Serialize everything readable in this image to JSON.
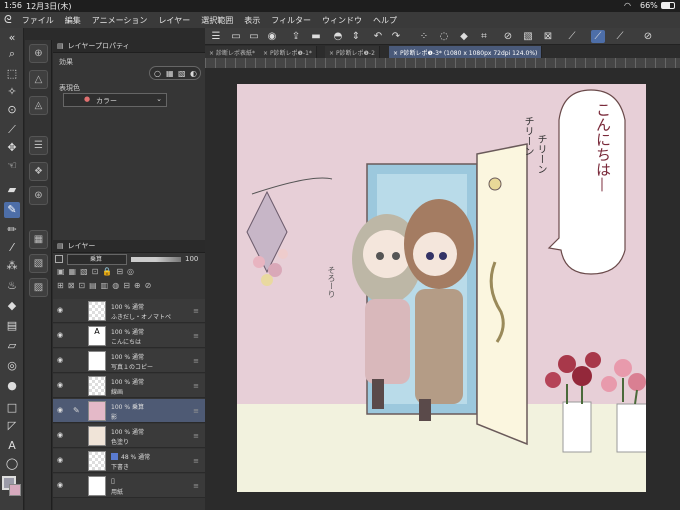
{
  "status": {
    "time": "1:56",
    "date": "12月3日(木)",
    "battery": "66%"
  },
  "menu": [
    "ファイル",
    "編集",
    "アニメーション",
    "レイヤー",
    "選択範囲",
    "表示",
    "フィルター",
    "ウィンドウ",
    "ヘルプ"
  ],
  "property_panel": {
    "tab_title": "レイヤープロパティ",
    "effect_label": "効果",
    "expression_label": "表現色",
    "expression_value": "カラー"
  },
  "layer_panel": {
    "tab_title": "レイヤー",
    "blend_mode": "乗算",
    "opacity": "100",
    "layers": [
      {
        "line1": "100 % 通常",
        "line2": "ふきだし・オノマトペ",
        "selected": false
      },
      {
        "line1": "100 % 通常",
        "line2": "こんにちは",
        "selected": false
      },
      {
        "line1": "100 % 通常",
        "line2": "写真１のコピー",
        "selected": false
      },
      {
        "line1": "100 % 通常",
        "line2": "線画",
        "selected": false
      },
      {
        "line1": "100 % 乗算",
        "line2": "影",
        "selected": true
      },
      {
        "line1": "100 % 通常",
        "line2": "色塗り",
        "selected": false
      },
      {
        "line1": "48 % 通常",
        "line2": "下書き",
        "selected": false
      },
      {
        "line1": "",
        "line2": "用紙",
        "selected": false
      }
    ]
  },
  "tabs": [
    {
      "label": "診断レポ表紙*",
      "active": false
    },
    {
      "label": "P診断レポ❶-1*",
      "active": false
    },
    {
      "label": "P診断レポ❶-2",
      "active": false
    },
    {
      "label": "P診断レポ❶-3* (1080 x 1080px 72dpi 124.0%)",
      "active": true
    }
  ],
  "canvas_text": {
    "speech": "こんにちは—",
    "sfx1": "チリーン",
    "sfx2": "チリーン",
    "sfx3": "そろーり"
  },
  "colors": {
    "accent": "#4d6ea8",
    "canvas_bg": "#e5cfd6",
    "door_yellow": "#fbf6df"
  }
}
